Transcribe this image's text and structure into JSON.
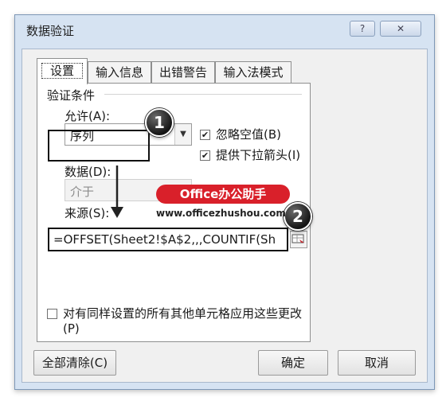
{
  "window": {
    "title": "数据验证",
    "help_glyph": "?",
    "close_glyph": "✕"
  },
  "tabs": [
    {
      "label": "设置",
      "active": true
    },
    {
      "label": "输入信息",
      "active": false
    },
    {
      "label": "出错警告",
      "active": false
    },
    {
      "label": "输入法模式",
      "active": false
    }
  ],
  "settings": {
    "group_title": "验证条件",
    "allow": {
      "label": "允许(A):",
      "value": "序列"
    },
    "ignore_blank": {
      "label": "忽略空值(B)",
      "checked": true
    },
    "dropdown": {
      "label": "提供下拉箭头(I)",
      "checked": true
    },
    "data": {
      "label": "数据(D):",
      "value": "介于",
      "disabled": true
    },
    "source": {
      "label": "来源(S):",
      "value": "=OFFSET(Sheet2!$A$2,,,COUNTIF(Sheet"
    },
    "apply_all": {
      "label": "对有同样设置的所有其他单元格应用这些更改(P)",
      "checked": false
    }
  },
  "annotations": {
    "badge1": "1",
    "badge2": "2",
    "arrow_glyph": "↓",
    "watermark_logo": "Office办公助手",
    "watermark_url": "www.officezhushou.com"
  },
  "buttons": {
    "clear_all": "全部清除(C)",
    "ok": "确定",
    "cancel": "取消"
  },
  "colors": {
    "window_frame": "#d6e3f2",
    "logo_bg": "#d9202a",
    "badge": "#151515"
  }
}
